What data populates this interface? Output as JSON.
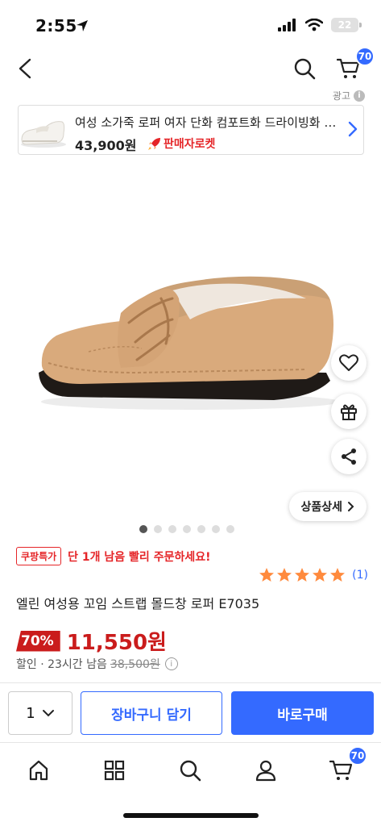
{
  "status": {
    "time": "2:55",
    "battery": "22"
  },
  "header": {
    "cart_count": "70"
  },
  "ad": {
    "label": "광고",
    "title": "여성 소가죽 로퍼 여자 단화 컴포트화 드라이빙화 로퍼",
    "price": "43,900원",
    "rocket_label": "판매자로켓"
  },
  "gallery": {
    "total": 7,
    "active": 0
  },
  "detail_button": "상품상세",
  "deal": {
    "tag": "쿠팡특가",
    "message": "단 1개 남음 빨리 주문하세요!"
  },
  "rating": {
    "stars": 5,
    "count": "(1)"
  },
  "product": {
    "title": "엘린 여성용 꼬임 스트랩 몰드창 로퍼 E7035",
    "discount": "70%",
    "price": "11,550원",
    "sub_prefix": "할인 · 23시간 남음",
    "original_price": "38,500원"
  },
  "purchase": {
    "quantity": "1",
    "cart_button": "장바구니 담기",
    "buy_button": "바로구매"
  },
  "tabbar": {
    "cart_count": "70"
  },
  "colors": {
    "accent": "#346aff",
    "sale": "#ca1c1c",
    "star": "#ff8a3d"
  }
}
